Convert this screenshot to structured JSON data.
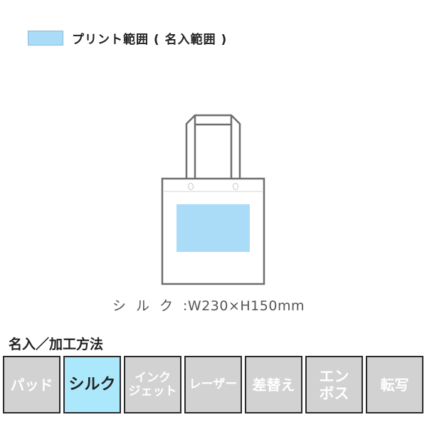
{
  "legend": {
    "label": "プリント範囲 ( 名入範囲 )",
    "swatch_color": "#aadcf8"
  },
  "product": {
    "icon": "tote-bag-outline",
    "print_area_color": "#aadcf8"
  },
  "dimensions": {
    "method": "シルク",
    "separator": ":",
    "size": "W230×H150mm"
  },
  "methods_section": {
    "title": "名入／加工方法",
    "items": [
      {
        "label": "パッド",
        "active": false
      },
      {
        "label": "シルク",
        "active": true
      },
      {
        "label": "インク\nジェット",
        "active": false
      },
      {
        "label": "レーザー",
        "active": false
      },
      {
        "label": "差替え",
        "active": false
      },
      {
        "label": "エン\nボス",
        "active": false
      },
      {
        "label": "転写",
        "active": false
      }
    ],
    "active_color": "#ace8fb",
    "inactive_color": "#d2d2d2"
  }
}
